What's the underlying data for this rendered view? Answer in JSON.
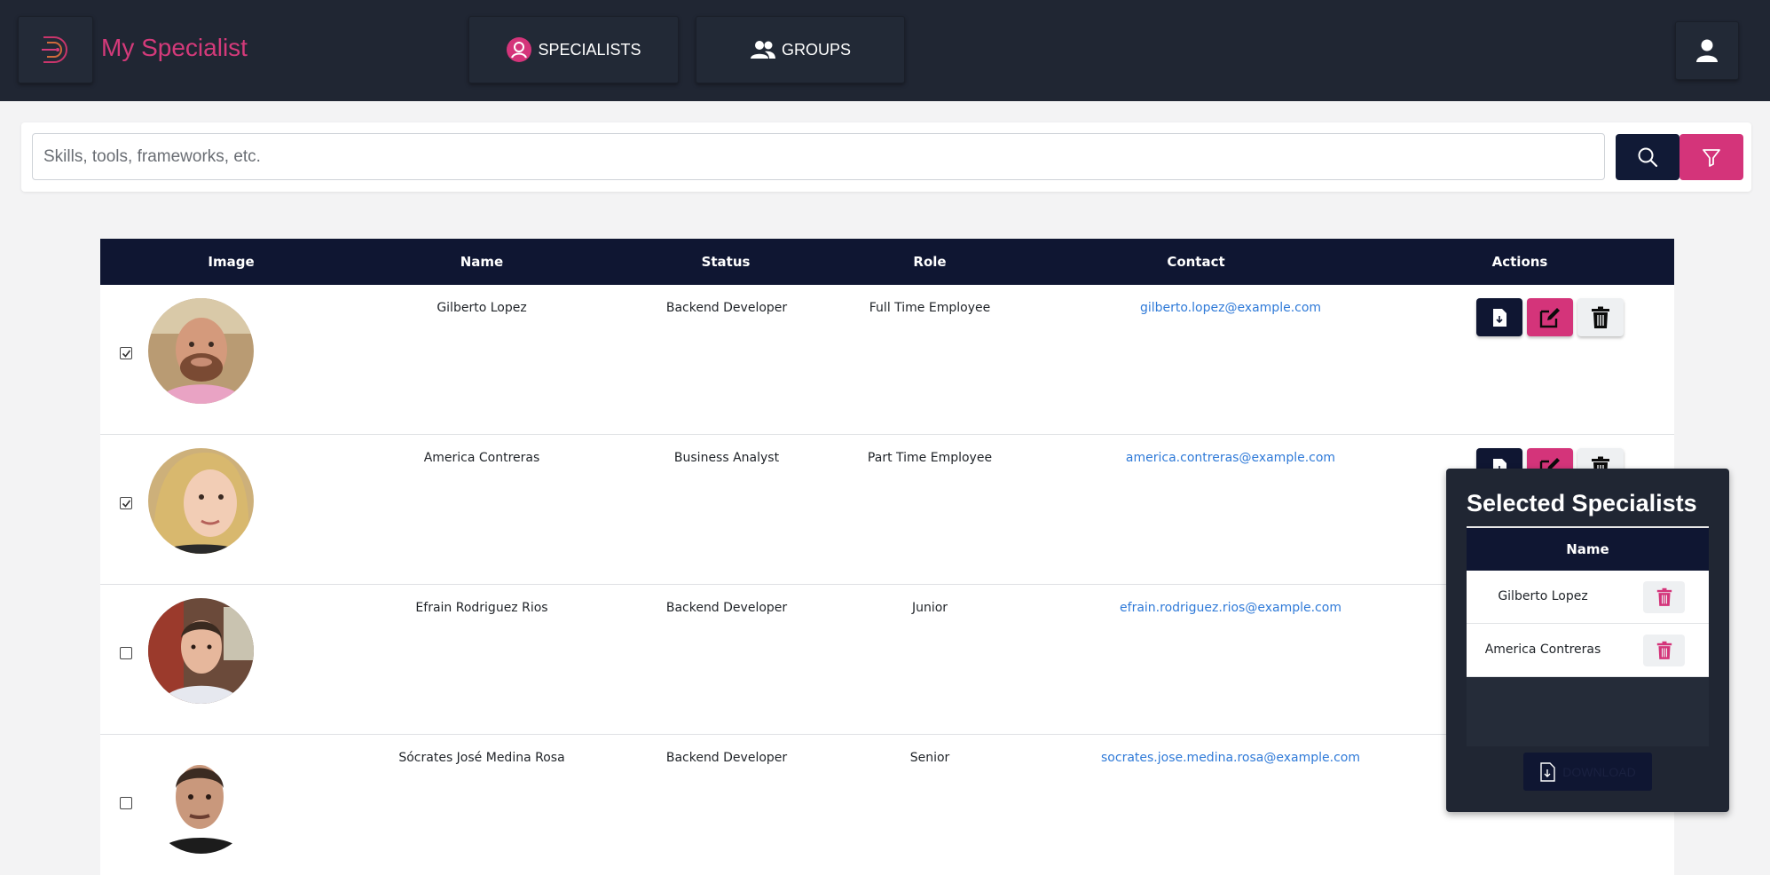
{
  "app": {
    "title": "My Specialist",
    "brand_color": "#d43a7a",
    "nav": [
      {
        "label": "SPECIALISTS",
        "icon": "user-circle-icon"
      },
      {
        "label": "GROUPS",
        "icon": "users-icon"
      }
    ],
    "user_icon": "user-icon"
  },
  "search": {
    "placeholder": "Skills, tools, frameworks, etc.",
    "value": "",
    "search_icon": "search-icon",
    "filter_icon": "filter-icon"
  },
  "table": {
    "headers": [
      "Image",
      "Name",
      "Status",
      "Role",
      "Contact",
      "Actions"
    ],
    "rows": [
      {
        "checked": true,
        "name": "Gilberto Lopez",
        "status": "Backend Developer",
        "role": "Full Time Employee",
        "contact": "gilberto.lopez@example.com"
      },
      {
        "checked": true,
        "name": "America Contreras",
        "status": "Business Analyst",
        "role": "Part Time Employee",
        "contact": "america.contreras@example.com"
      },
      {
        "checked": false,
        "name": "Efrain Rodriguez Rios",
        "status": "Backend Developer",
        "role": "Junior",
        "contact": "efrain.rodriguez.rios@example.com"
      },
      {
        "checked": false,
        "name": "Sócrates José Medina Rosa",
        "status": "Backend Developer",
        "role": "Senior",
        "contact": "socrates.jose.medina.rosa@example.com"
      }
    ],
    "action_icons": [
      "file-download-icon",
      "edit-icon",
      "trash-icon"
    ]
  },
  "selected_panel": {
    "title": "Selected Specialists",
    "column": "Name",
    "items": [
      "Gilberto Lopez",
      "America Contreras"
    ],
    "download_label": "DOWNLOAD"
  }
}
